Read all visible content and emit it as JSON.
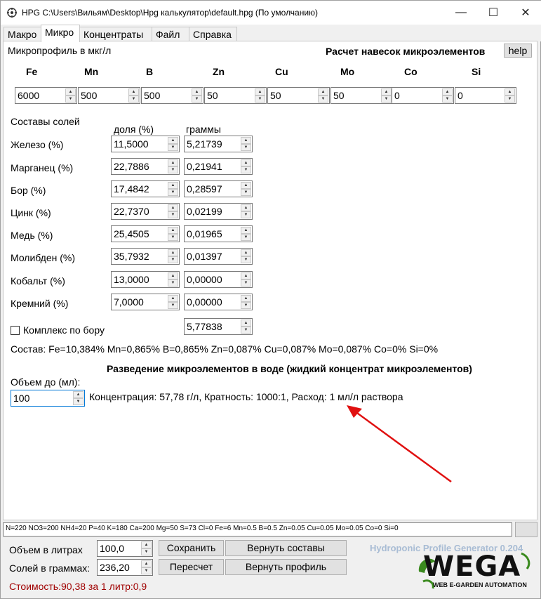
{
  "window": {
    "title": "HPG C:\\Users\\Вильям\\Desktop\\Hpg калькулятор\\default.hpg (По умолчанию)",
    "minimize": "—",
    "maximize": "☐",
    "close": "✕"
  },
  "tabs": [
    "Макро",
    "Микро",
    "Концентраты",
    "Файл",
    "Справка"
  ],
  "active_tab": "Микро",
  "micro": {
    "profile_label": "Микропрофиль в мкг/л",
    "calc_title": "Расчет навесок микроэлементов",
    "help_label": "help",
    "elements": [
      {
        "name": "Fe",
        "value": "6000"
      },
      {
        "name": "Mn",
        "value": "500"
      },
      {
        "name": "B",
        "value": "500"
      },
      {
        "name": "Zn",
        "value": "50"
      },
      {
        "name": "Cu",
        "value": "50"
      },
      {
        "name": "Mo",
        "value": "50"
      },
      {
        "name": "Co",
        "value": "0"
      },
      {
        "name": "Si",
        "value": "0"
      }
    ],
    "salts_title": "Составы солей",
    "col_share": "доля (%)",
    "col_grams": "граммы",
    "salts": [
      {
        "label": "Железо (%)",
        "share": "11,5000",
        "grams": "5,21739"
      },
      {
        "label": "Марганец (%)",
        "share": "22,7886",
        "grams": "0,21941"
      },
      {
        "label": "Бор (%)",
        "share": "17,4842",
        "grams": "0,28597"
      },
      {
        "label": "Цинк (%)",
        "share": "22,7370",
        "grams": "0,02199"
      },
      {
        "label": "Медь (%)",
        "share": "25,4505",
        "grams": "0,01965"
      },
      {
        "label": "Молибден (%)",
        "share": "35,7932",
        "grams": "0,01397"
      },
      {
        "label": "Кобальт (%)",
        "share": "13,0000",
        "grams": "0,00000"
      },
      {
        "label": "Кремний (%)",
        "share": "7,0000",
        "grams": "0,00000"
      }
    ],
    "complex_boron_label": "Комплекс по бору",
    "complex_boron_checked": false,
    "total_grams": "5,77838",
    "composition_text": "Состав: Fe=10,384% Mn=0,865% B=0,865% Zn=0,087% Cu=0,087% Mo=0,087% Co=0% Si=0%",
    "dilution_title": "Разведение микроэлементов в воде (жидкий концентрат микроэлементов)",
    "volume_label": "Объем до (мл):",
    "volume_value": "100",
    "concentration_text": "Концентрация: 57,78 г/л, Кратность: 1000:1, Расход: 1 мл/л раствора"
  },
  "status_line": "N=220 NO3=200 NH4=20 P=40 K=180 Ca=200 Mg=50 S=73 Cl=0 Fe=6 Mn=0.5 B=0.5 Zn=0.05 Cu=0.05 Mo=0.05 Co=0 Si=0",
  "footer": {
    "volume_liters_label": "Объем в литрах",
    "volume_liters_value": "100,0",
    "salts_grams_label": "Солей в граммах:",
    "salts_grams_value": "236,20",
    "save_label": "Сохранить",
    "recalc_label": "Пересчет",
    "restore_compositions_label": "Вернуть составы",
    "restore_profile_label": "Вернуть профиль",
    "cost_text": "Стоимость:90,38 за 1 литр:0,9",
    "generator_text": "Hydroponic Profile Generator 0.204",
    "logo_text": "WEGA",
    "logo_subtext": "WEB E-GARDEN AUTOMATION"
  },
  "colors": {
    "cost": "#a00000",
    "arrow": "#e01010",
    "logo_green": "#3a8a1e"
  }
}
